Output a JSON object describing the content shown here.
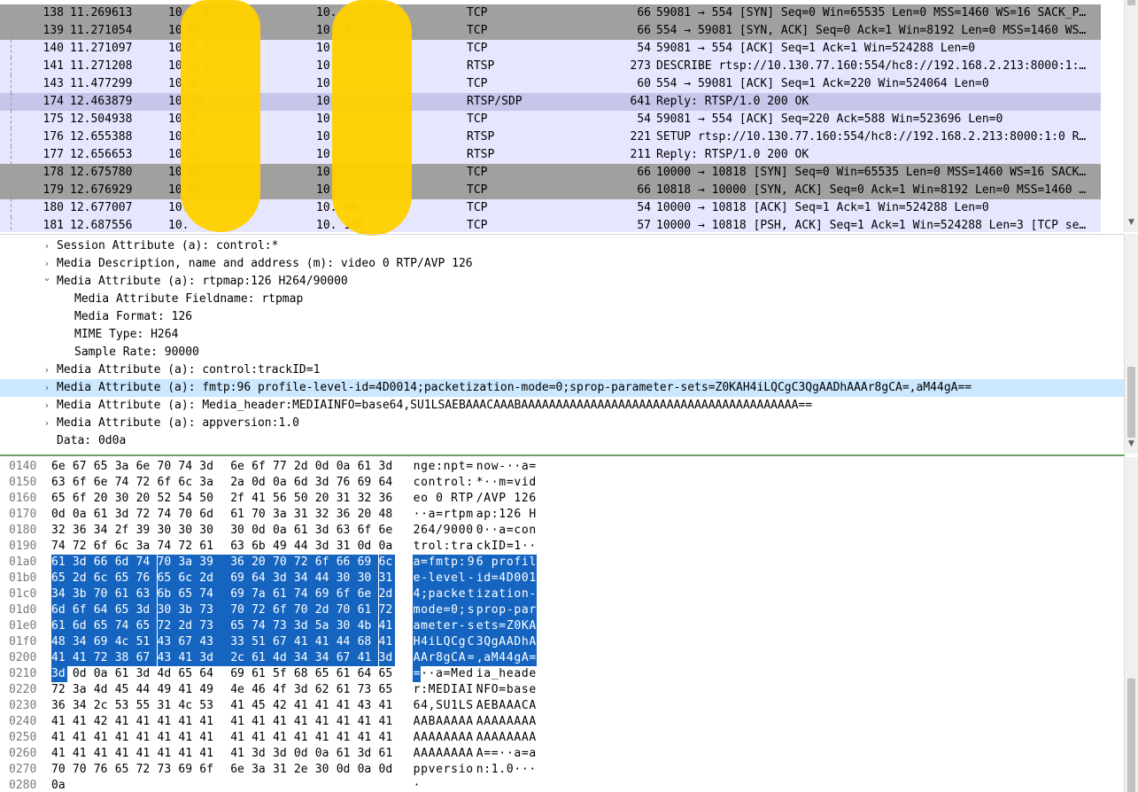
{
  "packets": [
    {
      "no": "138",
      "time": "11.269613",
      "src": "10.  .2",
      "dst": "10.   0",
      "proto": "TCP",
      "len": "66",
      "info": "59081 → 554 [SYN] Seq=0 Win=65535 Len=0 MSS=1460 WS=16 SACK_P…",
      "bg": "#a0a0a0"
    },
    {
      "no": "139",
      "time": "11.271054",
      "src": "10  0.",
      "dst": "10.   4",
      "proto": "TCP",
      "len": "66",
      "info": "554 → 59081 [SYN, ACK] Seq=0 Ack=1 Win=8192 Len=0 MSS=1460 WS…",
      "bg": "#a0a0a0"
    },
    {
      "no": "140",
      "time": "11.271097",
      "src": "10  0.2",
      "dst": "10.",
      "proto": "TCP",
      "len": "54",
      "info": "59081 → 554 [ACK] Seq=1 Ack=1 Win=524288 Len=0",
      "bg": "#e7e6ff"
    },
    {
      "no": "141",
      "time": "11.271208",
      "src": "10  0.2",
      "dst": "10.",
      "proto": "RTSP",
      "len": "273",
      "info": "DESCRIBE rtsp://10.130.77.160:554/hc8://192.168.2.213:8000:1:…",
      "bg": "#e7e6ff"
    },
    {
      "no": "143",
      "time": "11.477299",
      "src": "10  0.",
      "dst": "10.",
      "proto": "TCP",
      "len": "60",
      "info": "554 → 59081 [ACK] Seq=1 Ack=220 Win=524064 Len=0",
      "bg": "#e7e6ff"
    },
    {
      "no": "174",
      "time": "12.463879",
      "src": "10  30.",
      "dst": "10.",
      "proto": "RTSP/SDP",
      "len": "641",
      "info": "Reply: RTSP/1.0 200 OK",
      "bg": "#c6c5ea"
    },
    {
      "no": "175",
      "time": "12.504938",
      "src": "10  0.",
      "dst": "10.",
      "proto": "TCP",
      "len": "54",
      "info": "59081 → 554 [ACK] Seq=220 Ack=588 Win=523696 Len=0",
      "bg": "#e7e6ff"
    },
    {
      "no": "176",
      "time": "12.655388",
      "src": "10  0.",
      "dst": "10",
      "proto": "RTSP",
      "len": "221",
      "info": "SETUP rtsp://10.130.77.160:554/hc8://192.168.2.213:8000:1:0 R…",
      "bg": "#e7e6ff"
    },
    {
      "no": "177",
      "time": "12.656653",
      "src": "10  0.",
      "dst": "10.",
      "proto": "RTSP",
      "len": "211",
      "info": "Reply: RTSP/1.0 200 OK",
      "bg": "#e7e6ff"
    },
    {
      "no": "178",
      "time": "12.675780",
      "src": "10  0.",
      "dst": "10.",
      "proto": "TCP",
      "len": "66",
      "info": "10000 → 10818 [SYN] Seq=0 Win=65535 Len=0 MSS=1460 WS=16 SACK…",
      "bg": "#a0a0a0"
    },
    {
      "no": "179",
      "time": "12.676929",
      "src": "10  0.",
      "dst": "10.",
      "proto": "TCP",
      "len": "66",
      "info": "10818 → 10000 [SYN, ACK] Seq=0 Ack=1 Win=8192 Len=0 MSS=1460 …",
      "bg": "#a0a0a0"
    },
    {
      "no": "180",
      "time": "12.677007",
      "src": "10.",
      "dst": "10.  60",
      "proto": "TCP",
      "len": "54",
      "info": "10000 → 10818 [ACK] Seq=1 Ack=1 Win=524288 Len=0",
      "bg": "#e7e6ff"
    },
    {
      "no": "181",
      "time": "12.687556",
      "src": "10.",
      "dst": "10.  160",
      "proto": "TCP",
      "len": "57",
      "info": "10000 → 10818 [PSH, ACK] Seq=1 Ack=1 Win=524288 Len=3 [TCP se…",
      "bg": "#e7e6ff"
    }
  ],
  "details": [
    {
      "indent": 1,
      "expander": ">",
      "text": "Session Attribute (a): control:*",
      "selected": false
    },
    {
      "indent": 1,
      "expander": ">",
      "text": "Media Description, name and address (m): video 0 RTP/AVP 126",
      "selected": false
    },
    {
      "indent": 1,
      "expander": "v",
      "text": "Media Attribute (a): rtpmap:126 H264/90000",
      "selected": false
    },
    {
      "indent": 2,
      "expander": "",
      "text": "Media Attribute Fieldname: rtpmap",
      "selected": false
    },
    {
      "indent": 2,
      "expander": "",
      "text": "Media Format: 126",
      "selected": false
    },
    {
      "indent": 2,
      "expander": "",
      "text": "MIME Type: H264",
      "selected": false
    },
    {
      "indent": 2,
      "expander": "",
      "text": "Sample Rate: 90000",
      "selected": false
    },
    {
      "indent": 1,
      "expander": ">",
      "text": "Media Attribute (a): control:trackID=1",
      "selected": false
    },
    {
      "indent": 1,
      "expander": ">",
      "text": "Media Attribute (a): fmtp:96 profile-level-id=4D0014;packetization-mode=0;sprop-parameter-sets=Z0KAH4iLQCgC3QgAADhAAAr8gCA=,aM44gA==",
      "selected": true
    },
    {
      "indent": 1,
      "expander": ">",
      "text": "Media Attribute (a): Media_header:MEDIAINFO=base64,SU1LSAEBAAACAAABAAAAAAAAAAAAAAAAAAAAAAAAAAAAAAAAAAAAAAAA==",
      "selected": false
    },
    {
      "indent": 1,
      "expander": ">",
      "text": "Media Attribute (a): appversion:1.0",
      "selected": false
    },
    {
      "indent": 1,
      "expander": "",
      "text": "Data: 0d0a",
      "selected": false
    }
  ],
  "bytes_selection": {
    "start": 416,
    "end": 528
  },
  "bytes": [
    {
      "offset": "0140",
      "start": 320,
      "hex": [
        "6e",
        "67",
        "65",
        "3a",
        "6e",
        "70",
        "74",
        "3d",
        "6e",
        "6f",
        "77",
        "2d",
        "0d",
        "0a",
        "61",
        "3d"
      ],
      "ascii": "nge:npt=now-··a="
    },
    {
      "offset": "0150",
      "start": 336,
      "hex": [
        "63",
        "6f",
        "6e",
        "74",
        "72",
        "6f",
        "6c",
        "3a",
        "2a",
        "0d",
        "0a",
        "6d",
        "3d",
        "76",
        "69",
        "64"
      ],
      "ascii": "control:*··m=vid"
    },
    {
      "offset": "0160",
      "start": 352,
      "hex": [
        "65",
        "6f",
        "20",
        "30",
        "20",
        "52",
        "54",
        "50",
        "2f",
        "41",
        "56",
        "50",
        "20",
        "31",
        "32",
        "36"
      ],
      "ascii": "eo 0 RTP/AVP 126"
    },
    {
      "offset": "0170",
      "start": 368,
      "hex": [
        "0d",
        "0a",
        "61",
        "3d",
        "72",
        "74",
        "70",
        "6d",
        "61",
        "70",
        "3a",
        "31",
        "32",
        "36",
        "20",
        "48"
      ],
      "ascii": "··a=rtpmap:126 H"
    },
    {
      "offset": "0180",
      "start": 384,
      "hex": [
        "32",
        "36",
        "34",
        "2f",
        "39",
        "30",
        "30",
        "30",
        "30",
        "0d",
        "0a",
        "61",
        "3d",
        "63",
        "6f",
        "6e"
      ],
      "ascii": "264/90000··a=con"
    },
    {
      "offset": "0190",
      "start": 400,
      "hex": [
        "74",
        "72",
        "6f",
        "6c",
        "3a",
        "74",
        "72",
        "61",
        "63",
        "6b",
        "49",
        "44",
        "3d",
        "31",
        "0d",
        "0a"
      ],
      "ascii": "trol:trackID=1··"
    },
    {
      "offset": "01a0",
      "start": 416,
      "hex": [
        "61",
        "3d",
        "66",
        "6d",
        "74",
        "70",
        "3a",
        "39",
        "36",
        "20",
        "70",
        "72",
        "6f",
        "66",
        "69",
        "6c"
      ],
      "ascii": "a=fmtp:96 profil"
    },
    {
      "offset": "01b0",
      "start": 432,
      "hex": [
        "65",
        "2d",
        "6c",
        "65",
        "76",
        "65",
        "6c",
        "2d",
        "69",
        "64",
        "3d",
        "34",
        "44",
        "30",
        "30",
        "31"
      ],
      "ascii": "e-level-id=4D001"
    },
    {
      "offset": "01c0",
      "start": 448,
      "hex": [
        "34",
        "3b",
        "70",
        "61",
        "63",
        "6b",
        "65",
        "74",
        "69",
        "7a",
        "61",
        "74",
        "69",
        "6f",
        "6e",
        "2d"
      ],
      "ascii": "4;packetization-"
    },
    {
      "offset": "01d0",
      "start": 464,
      "hex": [
        "6d",
        "6f",
        "64",
        "65",
        "3d",
        "30",
        "3b",
        "73",
        "70",
        "72",
        "6f",
        "70",
        "2d",
        "70",
        "61",
        "72"
      ],
      "ascii": "mode=0;sprop-par"
    },
    {
      "offset": "01e0",
      "start": 480,
      "hex": [
        "61",
        "6d",
        "65",
        "74",
        "65",
        "72",
        "2d",
        "73",
        "65",
        "74",
        "73",
        "3d",
        "5a",
        "30",
        "4b",
        "41"
      ],
      "ascii": "ameter-sets=Z0KA"
    },
    {
      "offset": "01f0",
      "start": 496,
      "hex": [
        "48",
        "34",
        "69",
        "4c",
        "51",
        "43",
        "67",
        "43",
        "33",
        "51",
        "67",
        "41",
        "41",
        "44",
        "68",
        "41"
      ],
      "ascii": "H4iLQCgC3QgAADhA"
    },
    {
      "offset": "0200",
      "start": 512,
      "hex": [
        "41",
        "41",
        "72",
        "38",
        "67",
        "43",
        "41",
        "3d",
        "2c",
        "61",
        "4d",
        "34",
        "34",
        "67",
        "41",
        "3d"
      ],
      "ascii": "AAr8gCA=,aM44gA="
    },
    {
      "offset": "0210",
      "start": 528,
      "hex": [
        "3d",
        "0d",
        "0a",
        "61",
        "3d",
        "4d",
        "65",
        "64",
        "69",
        "61",
        "5f",
        "68",
        "65",
        "61",
        "64",
        "65"
      ],
      "ascii": "=··a=Media_heade"
    },
    {
      "offset": "0220",
      "start": 544,
      "hex": [
        "72",
        "3a",
        "4d",
        "45",
        "44",
        "49",
        "41",
        "49",
        "4e",
        "46",
        "4f",
        "3d",
        "62",
        "61",
        "73",
        "65"
      ],
      "ascii": "r:MEDIAINFO=base"
    },
    {
      "offset": "0230",
      "start": 560,
      "hex": [
        "36",
        "34",
        "2c",
        "53",
        "55",
        "31",
        "4c",
        "53",
        "41",
        "45",
        "42",
        "41",
        "41",
        "41",
        "43",
        "41"
      ],
      "ascii": "64,SU1LSAEBAAACA"
    },
    {
      "offset": "0240",
      "start": 576,
      "hex": [
        "41",
        "41",
        "42",
        "41",
        "41",
        "41",
        "41",
        "41",
        "41",
        "41",
        "41",
        "41",
        "41",
        "41",
        "41",
        "41"
      ],
      "ascii": "AABAAAAAAAAAAAAA"
    },
    {
      "offset": "0250",
      "start": 592,
      "hex": [
        "41",
        "41",
        "41",
        "41",
        "41",
        "41",
        "41",
        "41",
        "41",
        "41",
        "41",
        "41",
        "41",
        "41",
        "41",
        "41"
      ],
      "ascii": "AAAAAAAAAAAAAAAA"
    },
    {
      "offset": "0260",
      "start": 608,
      "hex": [
        "41",
        "41",
        "41",
        "41",
        "41",
        "41",
        "41",
        "41",
        "41",
        "3d",
        "3d",
        "0d",
        "0a",
        "61",
        "3d",
        "61"
      ],
      "ascii": "AAAAAAAAA==··a=a"
    },
    {
      "offset": "0270",
      "start": 624,
      "hex": [
        "70",
        "70",
        "76",
        "65",
        "72",
        "73",
        "69",
        "6f",
        "6e",
        "3a",
        "31",
        "2e",
        "30",
        "0d",
        "0a",
        "0d"
      ],
      "ascii": "ppversion:1.0···"
    },
    {
      "offset": "0280",
      "start": 640,
      "hex": [
        "0a"
      ],
      "ascii": "·"
    }
  ],
  "colors": {
    "selection": "#1565c0",
    "tcp_gray": "#a0a0a0",
    "tcp_light": "#e7e6ff",
    "sdp": "#c6c5ea",
    "detail_selected": "#cce8ff",
    "redaction": "#ffd000"
  }
}
